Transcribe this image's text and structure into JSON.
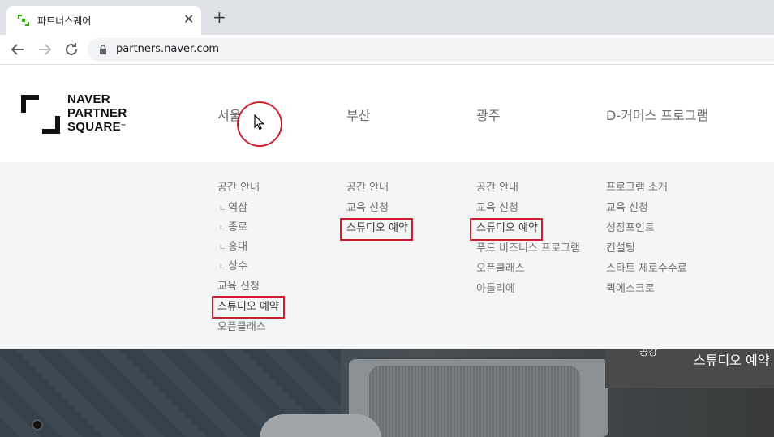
{
  "browser": {
    "tab_title": "파트너스퀘어",
    "url": "partners.naver.com",
    "favicon_color": "#2db400"
  },
  "logo": {
    "line1": "NAVER",
    "line2": "PARTNER",
    "line3": "SQUARE",
    "tm": "™"
  },
  "gnb": [
    {
      "label": "서울"
    },
    {
      "label": "부산"
    },
    {
      "label": "광주"
    },
    {
      "label": "D-커머스 프로그램"
    }
  ],
  "menus": {
    "seoul": [
      "공간 안내",
      "역삼",
      "종로",
      "홍대",
      "상수",
      "교육 신청",
      "스튜디오 예약",
      "오픈클래스"
    ],
    "busan": [
      "공간 안내",
      "교육 신청",
      "스튜디오 예약"
    ],
    "gwangju": [
      "공간 안내",
      "교육 신청",
      "스튜디오 예약",
      "푸드 비즈니스 프로그램",
      "오픈클래스",
      "아틀리에"
    ],
    "dcommerce": [
      "프로그램 소개",
      "교육 신청",
      "성장포인트",
      "컨설팅",
      "스타트 제로수수료",
      "퀵에스크로"
    ]
  },
  "hero": {
    "text": "스튜디오 예약",
    "partial_text": "공강"
  },
  "colors": {
    "highlight": "#d0202d",
    "dropdown_bg": "#f4f5f6"
  }
}
